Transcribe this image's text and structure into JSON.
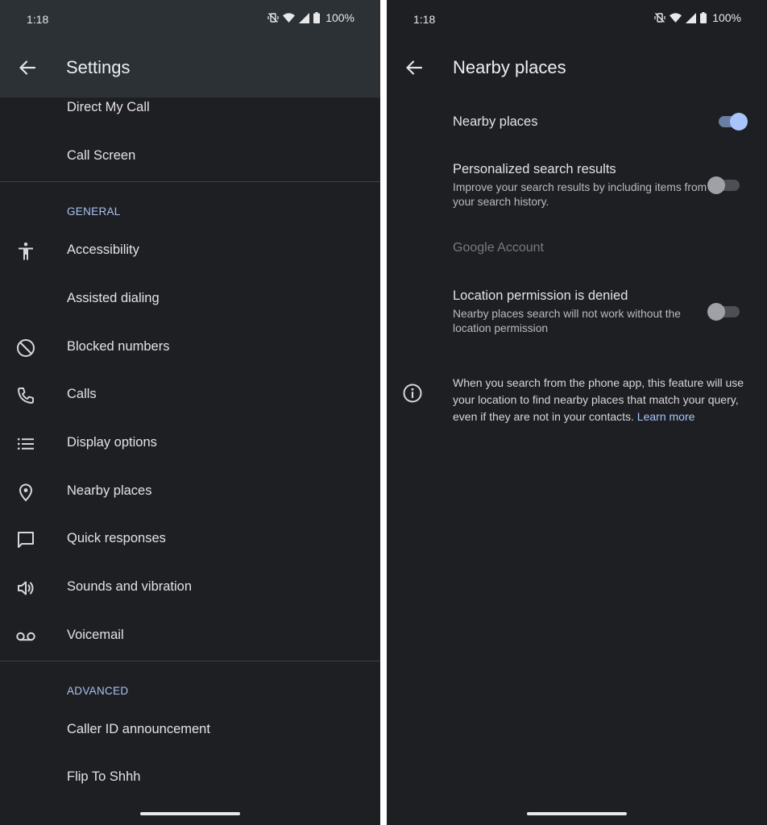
{
  "status": {
    "time": "1:18",
    "battery": "100%"
  },
  "left": {
    "title": "Settings",
    "top_items": [
      "Direct My Call",
      "Call Screen"
    ],
    "general_header": "GENERAL",
    "general_items": [
      {
        "label": "Accessibility",
        "icon": "accessibility-icon"
      },
      {
        "label": "Assisted dialing",
        "icon": ""
      },
      {
        "label": "Blocked numbers",
        "icon": "block-icon"
      },
      {
        "label": "Calls",
        "icon": "phone-icon"
      },
      {
        "label": "Display options",
        "icon": "list-icon"
      },
      {
        "label": "Nearby places",
        "icon": "location-pin-icon"
      },
      {
        "label": "Quick responses",
        "icon": "chat-bubble-icon"
      },
      {
        "label": "Sounds and vibration",
        "icon": "volume-icon"
      },
      {
        "label": "Voicemail",
        "icon": "voicemail-icon"
      }
    ],
    "advanced_header": "ADVANCED",
    "advanced_items": [
      "Caller ID announcement",
      "Flip To Shhh"
    ]
  },
  "right": {
    "title": "Nearby places",
    "nearby_places": {
      "title": "Nearby places",
      "enabled": true
    },
    "personalized": {
      "title": "Personalized search results",
      "summary": "Improve your search results by including items from your search history.",
      "enabled": false
    },
    "category": "Google Account",
    "location_permission": {
      "title": "Location permission is denied",
      "summary": "Nearby places search will not work without the location permission",
      "enabled": false
    },
    "footer": {
      "text": "When you search from the phone app, this feature will use your location to find nearby places that match your query, even if they are not in your contacts.",
      "link": "Learn more"
    }
  },
  "colors": {
    "background": "#1e1f22",
    "app_bar": "#2c3136",
    "accent": "#a8c4ff",
    "section_header": "#a9c2f4"
  }
}
